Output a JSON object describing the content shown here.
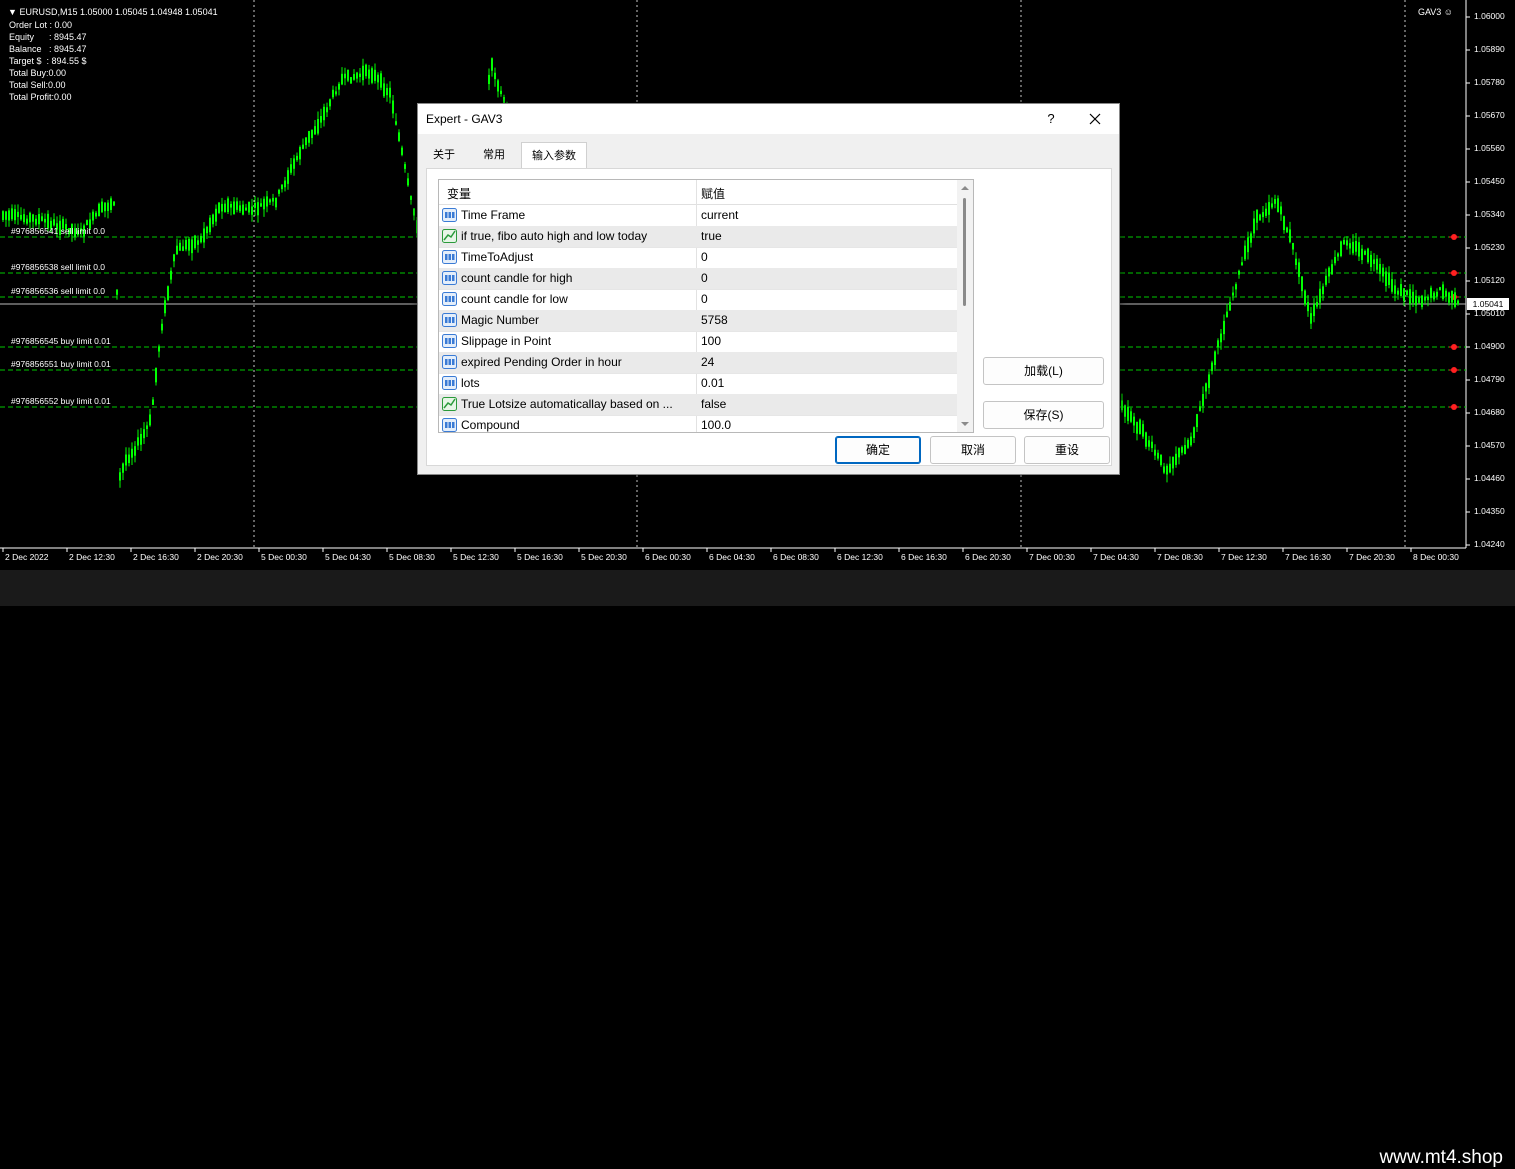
{
  "chart": {
    "symbol_header": "EURUSD,M15  1.05000 1.05045 1.04948 1.05041",
    "account_lines": [
      "Order Lot : 0.00",
      "Equity      : 8945.47",
      "Balance   : 8945.47",
      "Target $  : 894.55 $",
      "Total Buy:0.00",
      "Total Sell:0.00",
      "Total Profit:0.00"
    ],
    "ea_badge": "GAV3",
    "current_price": "1.05041",
    "price_levels": [
      "1.06000",
      "1.05890",
      "1.05780",
      "1.05670",
      "1.05560",
      "1.05450",
      "1.05340",
      "1.05230",
      "1.05120",
      "1.05010",
      "1.04900",
      "1.04790",
      "1.04680",
      "1.04570",
      "1.04460",
      "1.04350",
      "1.04240"
    ],
    "time_labels": [
      "2 Dec 2022",
      "2 Dec 12:30",
      "2 Dec 16:30",
      "2 Dec 20:30",
      "5 Dec 00:30",
      "5 Dec 04:30",
      "5 Dec 08:30",
      "5 Dec 12:30",
      "5 Dec 16:30",
      "5 Dec 20:30",
      "6 Dec 00:30",
      "6 Dec 04:30",
      "6 Dec 08:30",
      "6 Dec 12:30",
      "6 Dec 16:30",
      "6 Dec 20:30",
      "7 Dec 00:30",
      "7 Dec 04:30",
      "7 Dec 08:30",
      "7 Dec 12:30",
      "7 Dec 16:30",
      "7 Dec 20:30",
      "8 Dec 00:30"
    ],
    "orders": [
      {
        "label": "#976856541 sell limit 0.0"
      },
      {
        "label": "#976856538 sell limit 0.0"
      },
      {
        "label": "#976856536 sell limit 0.0"
      },
      {
        "label": "#976856545 buy limit 0.01"
      },
      {
        "label": "#976856551 buy limit 0.01"
      },
      {
        "label": "#976856552 buy limit 0.01"
      }
    ],
    "candle_color": "#00ff00",
    "order_line_color": "#00c800"
  },
  "dialog": {
    "title": "Expert - GAV3",
    "help": "?",
    "tabs": [
      "关于",
      "常用",
      "输入参数"
    ],
    "active_tab": 2,
    "grid": {
      "col_variable": "变量",
      "col_value": "赋值",
      "rows": [
        {
          "icon": "int",
          "name": "Time Frame",
          "value": "current"
        },
        {
          "icon": "bool",
          "name": "if true, fibo auto high and low today",
          "value": "true"
        },
        {
          "icon": "int",
          "name": "TimeToAdjust",
          "value": "0"
        },
        {
          "icon": "int",
          "name": "count candle for high",
          "value": "0"
        },
        {
          "icon": "int",
          "name": "count candle for low",
          "value": "0"
        },
        {
          "icon": "int",
          "name": "Magic Number",
          "value": "5758"
        },
        {
          "icon": "int",
          "name": "Slippage in Point",
          "value": "100"
        },
        {
          "icon": "int",
          "name": "expired Pending Order in hour",
          "value": "24"
        },
        {
          "icon": "dbl",
          "name": "lots",
          "value": "0.01"
        },
        {
          "icon": "bool",
          "name": "True Lotsize automaticallay based on ...",
          "value": "false"
        },
        {
          "icon": "int",
          "name": "Compound",
          "value": "100.0"
        }
      ]
    },
    "load_button": "加载(L)",
    "save_button": "保存(S)",
    "ok_button": "确定",
    "cancel_button": "取消",
    "reset_button": "重设"
  },
  "watermark": "www.mt4.shop"
}
